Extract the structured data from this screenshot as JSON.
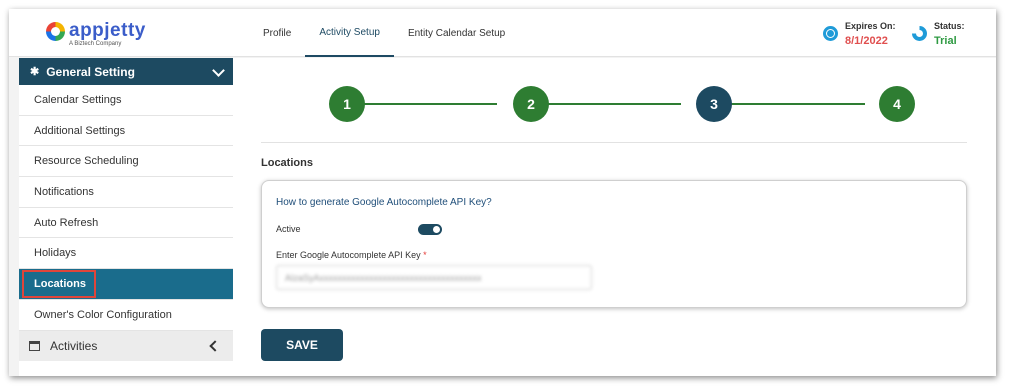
{
  "brand": {
    "name": "appjetty",
    "tagline": "A Biztech Company"
  },
  "header": {
    "tabs": [
      {
        "label": "Profile",
        "active": false
      },
      {
        "label": "Activity Setup",
        "active": true
      },
      {
        "label": "Entity Calendar Setup",
        "active": false
      }
    ],
    "expires": {
      "label": "Expires On:",
      "value": "8/1/2022",
      "color": "#e04f4f",
      "icon": "globe-icon"
    },
    "status": {
      "label": "Status:",
      "value": "Trial",
      "color": "#2e9a42",
      "icon": "status-icon"
    }
  },
  "sidebar": {
    "section_title": "General Setting",
    "items": [
      {
        "label": "Calendar Settings",
        "active": false
      },
      {
        "label": "Additional Settings",
        "active": false
      },
      {
        "label": "Resource Scheduling",
        "active": false
      },
      {
        "label": "Notifications",
        "active": false
      },
      {
        "label": "Auto Refresh",
        "active": false
      },
      {
        "label": "Holidays",
        "active": false
      },
      {
        "label": "Locations",
        "active": true
      },
      {
        "label": "Owner's Color Configuration",
        "active": false
      }
    ],
    "activities_label": "Activities"
  },
  "stepper": {
    "steps": [
      {
        "label": "1",
        "state": "complete"
      },
      {
        "label": "2",
        "state": "complete"
      },
      {
        "label": "3",
        "state": "current"
      },
      {
        "label": "4",
        "state": "complete"
      }
    ],
    "colors": {
      "complete": "#2e7d32",
      "current": "#1d4a61"
    }
  },
  "main": {
    "section_title": "Locations",
    "help_link": "How to generate Google Autocomplete API Key?",
    "active_label": "Active",
    "active_on": true,
    "api_key_label": "Enter Google Autocomplete API Key",
    "api_key_required_mark": "*",
    "api_key_value": "AIzaSyAxxxxxxxxxxxxxxxxxxxxxxxxxxxxxxxxxxxx",
    "save_label": "SAVE"
  },
  "colors": {
    "primary": "#1d4a61",
    "active_item": "#1a6c8c",
    "highlight_border": "#e0453a"
  }
}
